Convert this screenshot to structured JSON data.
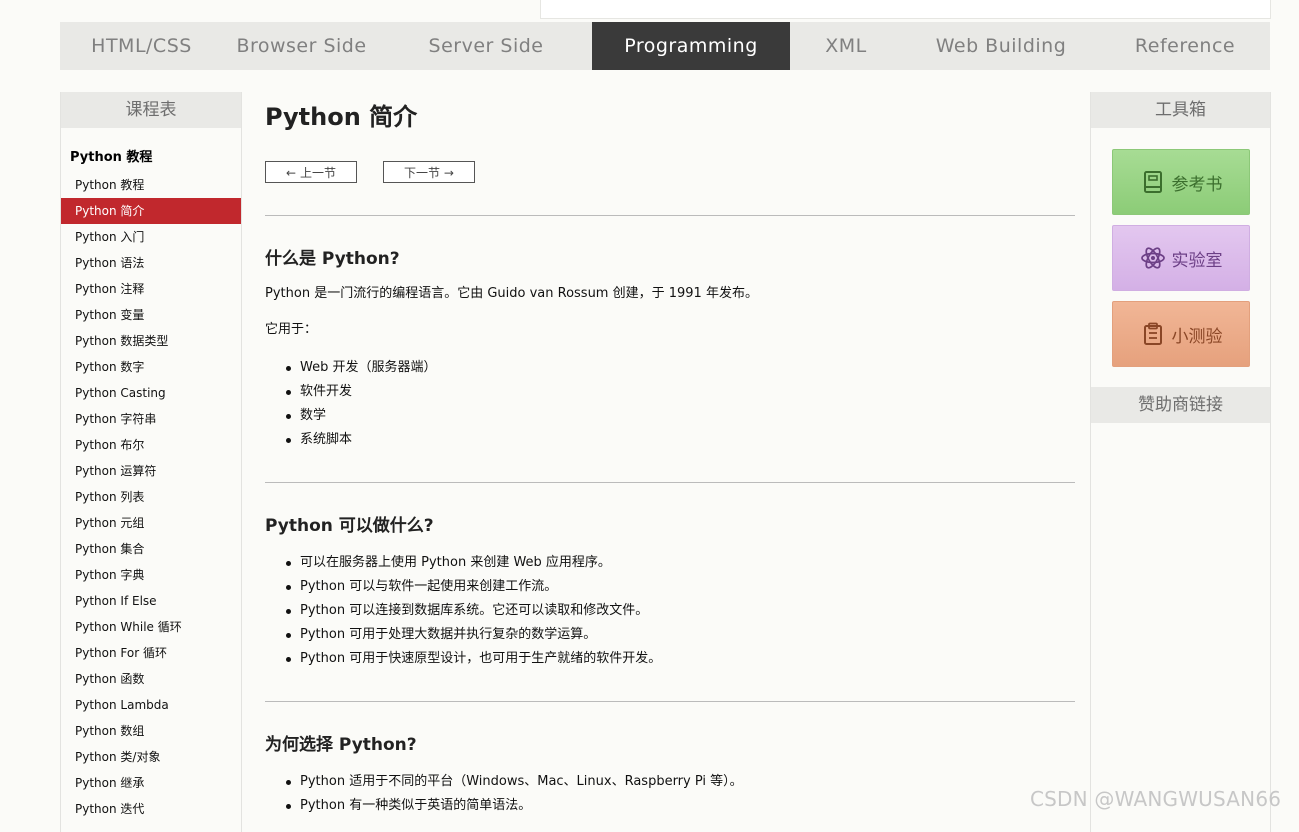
{
  "top_nav": [
    {
      "label": "HTML/CSS",
      "active": false
    },
    {
      "label": "Browser Side",
      "active": false
    },
    {
      "label": "Server Side",
      "active": false
    },
    {
      "label": "Programming",
      "active": true
    },
    {
      "label": "XML",
      "active": false
    },
    {
      "label": "Web Building",
      "active": false
    },
    {
      "label": "Reference",
      "active": false
    }
  ],
  "left_sidebar": {
    "heading": "课程表",
    "group_title": "Python 教程",
    "items": [
      {
        "label": "Python 教程"
      },
      {
        "label": "Python 简介",
        "active": true
      },
      {
        "label": "Python 入门"
      },
      {
        "label": "Python 语法"
      },
      {
        "label": "Python 注释"
      },
      {
        "label": "Python 变量"
      },
      {
        "label": "Python 数据类型"
      },
      {
        "label": "Python 数字"
      },
      {
        "label": "Python Casting"
      },
      {
        "label": "Python 字符串"
      },
      {
        "label": "Python 布尔"
      },
      {
        "label": "Python 运算符"
      },
      {
        "label": "Python 列表"
      },
      {
        "label": "Python 元组"
      },
      {
        "label": "Python 集合"
      },
      {
        "label": "Python 字典"
      },
      {
        "label": "Python If Else"
      },
      {
        "label": "Python While 循环"
      },
      {
        "label": "Python For 循环"
      },
      {
        "label": "Python 函数"
      },
      {
        "label": "Python Lambda"
      },
      {
        "label": "Python 数组"
      },
      {
        "label": "Python 类/对象"
      },
      {
        "label": "Python 继承"
      },
      {
        "label": "Python 迭代"
      }
    ]
  },
  "main": {
    "title": "Python 简介",
    "prev_label": "上一节",
    "next_label": "下一节",
    "sections": [
      {
        "heading": "什么是 Python?",
        "paragraphs": [
          "Python 是一门流行的编程语言。它由 Guido van Rossum 创建，于 1991 年发布。",
          "它用于："
        ],
        "bullets": [
          "Web 开发（服务器端）",
          "软件开发",
          "数学",
          "系统脚本"
        ]
      },
      {
        "heading": "Python 可以做什么?",
        "bullets": [
          "可以在服务器上使用 Python 来创建 Web 应用程序。",
          "Python 可以与软件一起使用来创建工作流。",
          "Python 可以连接到数据库系统。它还可以读取和修改文件。",
          "Python 可用于处理大数据并执行复杂的数学运算。",
          "Python 可用于快速原型设计，也可用于生产就绪的软件开发。"
        ]
      },
      {
        "heading": "为何选择 Python?",
        "bullets": [
          "Python 适用于不同的平台（Windows、Mac、Linux、Raspberry Pi 等）。",
          "Python 有一种类似于英语的简单语法。"
        ]
      }
    ]
  },
  "right_sidebar": {
    "heading": "工具箱",
    "buttons": [
      {
        "label": "参考书",
        "icon": "book-icon"
      },
      {
        "label": "实验室",
        "icon": "atom-icon"
      },
      {
        "label": "小测验",
        "icon": "clipboard-icon"
      }
    ],
    "sponsor_heading": "赞助商链接"
  },
  "watermark": "CSDN @WANGWUSAN66"
}
